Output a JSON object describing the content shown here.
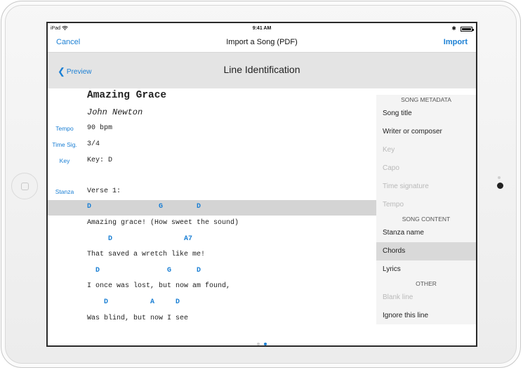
{
  "status_bar": {
    "carrier": "iPad",
    "time": "9:41 AM",
    "bluetooth": "✱"
  },
  "nav": {
    "cancel": "Cancel",
    "title": "Import a Song (PDF)",
    "import": "Import"
  },
  "subheader": {
    "back": "Preview",
    "title": "Line Identification"
  },
  "lines": [
    {
      "label": "",
      "text": "Amazing Grace",
      "style": "title"
    },
    {
      "label": "",
      "text": "John Newton",
      "style": "writer"
    },
    {
      "label": "Tempo",
      "text": "90 bpm",
      "style": "normal"
    },
    {
      "label": "Time Sig.",
      "text": "3/4",
      "style": "normal"
    },
    {
      "label": "Key",
      "text": "Key: D",
      "style": "normal"
    },
    {
      "label": "",
      "text": "",
      "style": "normal"
    },
    {
      "label": "Stanza",
      "text": "Verse 1:",
      "style": "normal"
    },
    {
      "label": "",
      "text": "D                G        D",
      "style": "chord",
      "selected": true
    },
    {
      "label": "",
      "text": "Amazing grace! (How sweet the sound)",
      "style": "normal"
    },
    {
      "label": "",
      "text": "     D                 A7",
      "style": "chord"
    },
    {
      "label": "",
      "text": "That saved a wretch like me!",
      "style": "normal"
    },
    {
      "label": "",
      "text": "  D                G      D",
      "style": "chord"
    },
    {
      "label": "",
      "text": "I once was lost, but now am found,",
      "style": "normal"
    },
    {
      "label": "",
      "text": "    D          A     D",
      "style": "chord"
    },
    {
      "label": "",
      "text": "Was blind, but now I see",
      "style": "normal"
    }
  ],
  "menu": {
    "song_metadata_header": "SONG METADATA",
    "song_title": "Song title",
    "writer": "Writer or composer",
    "key": "Key",
    "capo": "Capo",
    "time_signature": "Time signature",
    "tempo": "Tempo",
    "song_content_header": "SONG CONTENT",
    "stanza_name": "Stanza name",
    "chords": "Chords",
    "lyrics": "Lyrics",
    "other_header": "OTHER",
    "blank_line": "Blank line",
    "ignore_line": "Ignore this line"
  },
  "page_indicator": {
    "pages": 2,
    "current": 2
  },
  "colors": {
    "accent": "#1a7fd4",
    "selected_row": "#d4d4d4",
    "header_bg": "#e4e4e4"
  }
}
